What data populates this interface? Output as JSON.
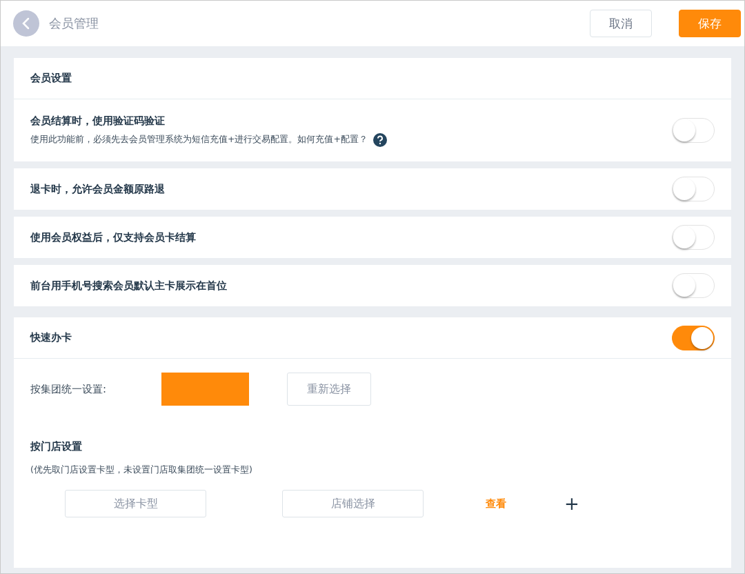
{
  "header": {
    "title": "会员管理",
    "buttons": [
      {
        "label": "取消",
        "kind": "secondary"
      },
      {
        "label": "保存",
        "kind": "primary"
      }
    ]
  },
  "settings_card": {
    "title": "会员设置",
    "item": {
      "label": "会员结算时，使用验证码验证",
      "note": "使用此功能前，必须先去会员管理系统为短信充值+进行交易配置。如何充值+配置？",
      "on": false
    }
  },
  "toggle_cards": [
    {
      "label": "退卡时，允许会员金额原路退",
      "on": false
    },
    {
      "label": "使用会员权益后，仅支持会员卡结算",
      "on": false
    },
    {
      "label": "前台用手机号搜索会员默认主卡展示在首位",
      "on": false
    }
  ],
  "quick_card": {
    "title": "快速办卡",
    "on": true,
    "group_label": "按集团统一设置:",
    "reselect_button": "重新选择",
    "store_title": "按门店设置",
    "store_note": "(优先取门店设置卡型，未设置门店取集团统一设置卡型)",
    "card_type_button": "选择卡型",
    "store_button": "店铺选择",
    "view_link": "查看",
    "add_button": "+"
  }
}
